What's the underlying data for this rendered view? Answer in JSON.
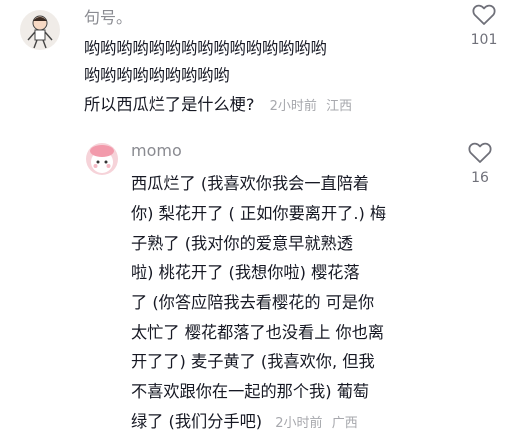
{
  "comment": {
    "username": "句号。",
    "text_lines": [
      "哟哟哟哟哟哟哟哟哟哟哟哟哟哟哟",
      "哟哟哟哟哟哟哟哟哟",
      "所以西瓜烂了是什么梗?"
    ],
    "time": "2小时前",
    "location": "江西",
    "likes": "101",
    "like_icon": "heart-outline-icon"
  },
  "reply": {
    "username": "momo",
    "text_lines": [
      "西瓜烂了 (我喜欢你我会一直陪着",
      "你) 梨花开了 ( 正如你要离开了.) 梅",
      "子熟了 (我对你的爱意早就熟透",
      "啦) 桃花开了 (我想你啦) 樱花落",
      "了 (你答应陪我去看樱花的 可是你",
      "太忙了 樱花都落了也没看上 你也离",
      "开了了) 麦子黄了 (我喜欢你, 但我",
      "不喜欢跟你在一起的那个我) 葡萄",
      "绿了 (我们分手吧)"
    ],
    "time": "2小时前",
    "location": "广西",
    "likes": "16",
    "like_icon": "heart-outline-icon"
  }
}
